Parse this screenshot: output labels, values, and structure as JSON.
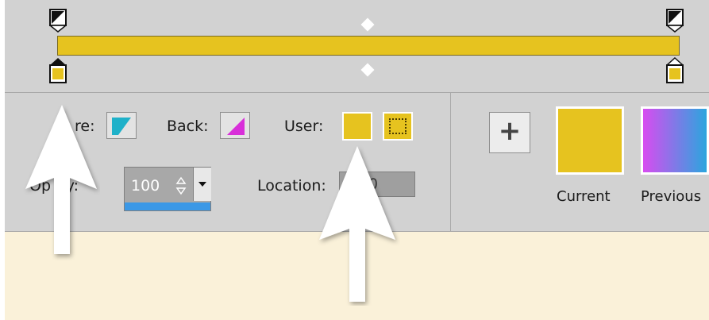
{
  "gradient_editor": {
    "colors": {
      "gradient_start": "#e6c31f",
      "gradient_end": "#e6c31f",
      "background_panel": "#d2d2d2",
      "lower_area": "#faf1d9",
      "accent": "#3b98e6",
      "previous_gradient": [
        "#d84cf0",
        "#2aa6de"
      ]
    },
    "stops": {
      "opacity_stop_left_icon": "opacity-stop-icon",
      "opacity_stop_right_icon": "opacity-stop-icon",
      "color_stop_left_icon": "color-stop-icon",
      "color_stop_right_icon": "color-stop-icon"
    },
    "labels": {
      "fore": "re:",
      "back": "Back:",
      "user": "User:",
      "opacity": "Op    ity:",
      "location": "Location:"
    },
    "opacity_value": "100",
    "location_value": "0",
    "add_button_label": "+",
    "swatches": {
      "current_label": "Current",
      "previous_label": "Previous"
    },
    "annotations": {
      "arrow_icons": [
        "arrow-up-icon",
        "arrow-up-icon"
      ]
    }
  }
}
